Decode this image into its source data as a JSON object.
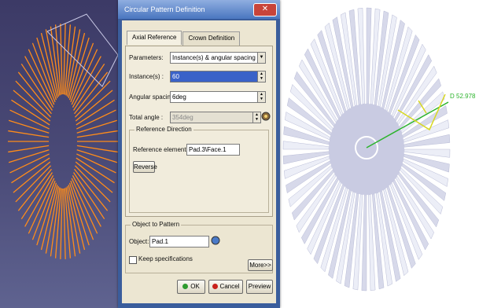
{
  "dialog": {
    "title": "Circular Pattern Definition",
    "tabs": [
      "Axial Reference",
      "Crown Definition"
    ],
    "parameters": {
      "label": "Parameters:",
      "value": "Instance(s) & angular spacing"
    },
    "instances": {
      "label": "Instance(s) :",
      "value": "60"
    },
    "angular_spacing": {
      "label": "Angular spacing :",
      "value": "6deg"
    },
    "total_angle": {
      "label": "Total angle :",
      "value": "354deg"
    },
    "reference_direction": {
      "title": "Reference Direction",
      "element_label": "Reference element:",
      "element_value": "Pad.3\\Face.1",
      "reverse_label": "Reverse"
    },
    "object_to_pattern": {
      "title": "Object to Pattern",
      "object_label": "Object:",
      "object_value": "Pad.1",
      "keep_label": "Keep specifications"
    },
    "more_label": "More>>",
    "ok_label": "OK",
    "cancel_label": "Cancel",
    "preview_label": "Preview",
    "close_label": "✕"
  },
  "viewport": {
    "dimension_label": "D 52.978"
  },
  "colors": {
    "orange": "#ff8c1a",
    "ok_green": "#2e9b2e",
    "cancel_red": "#c8201a",
    "dimension_green": "#2bb32b"
  }
}
